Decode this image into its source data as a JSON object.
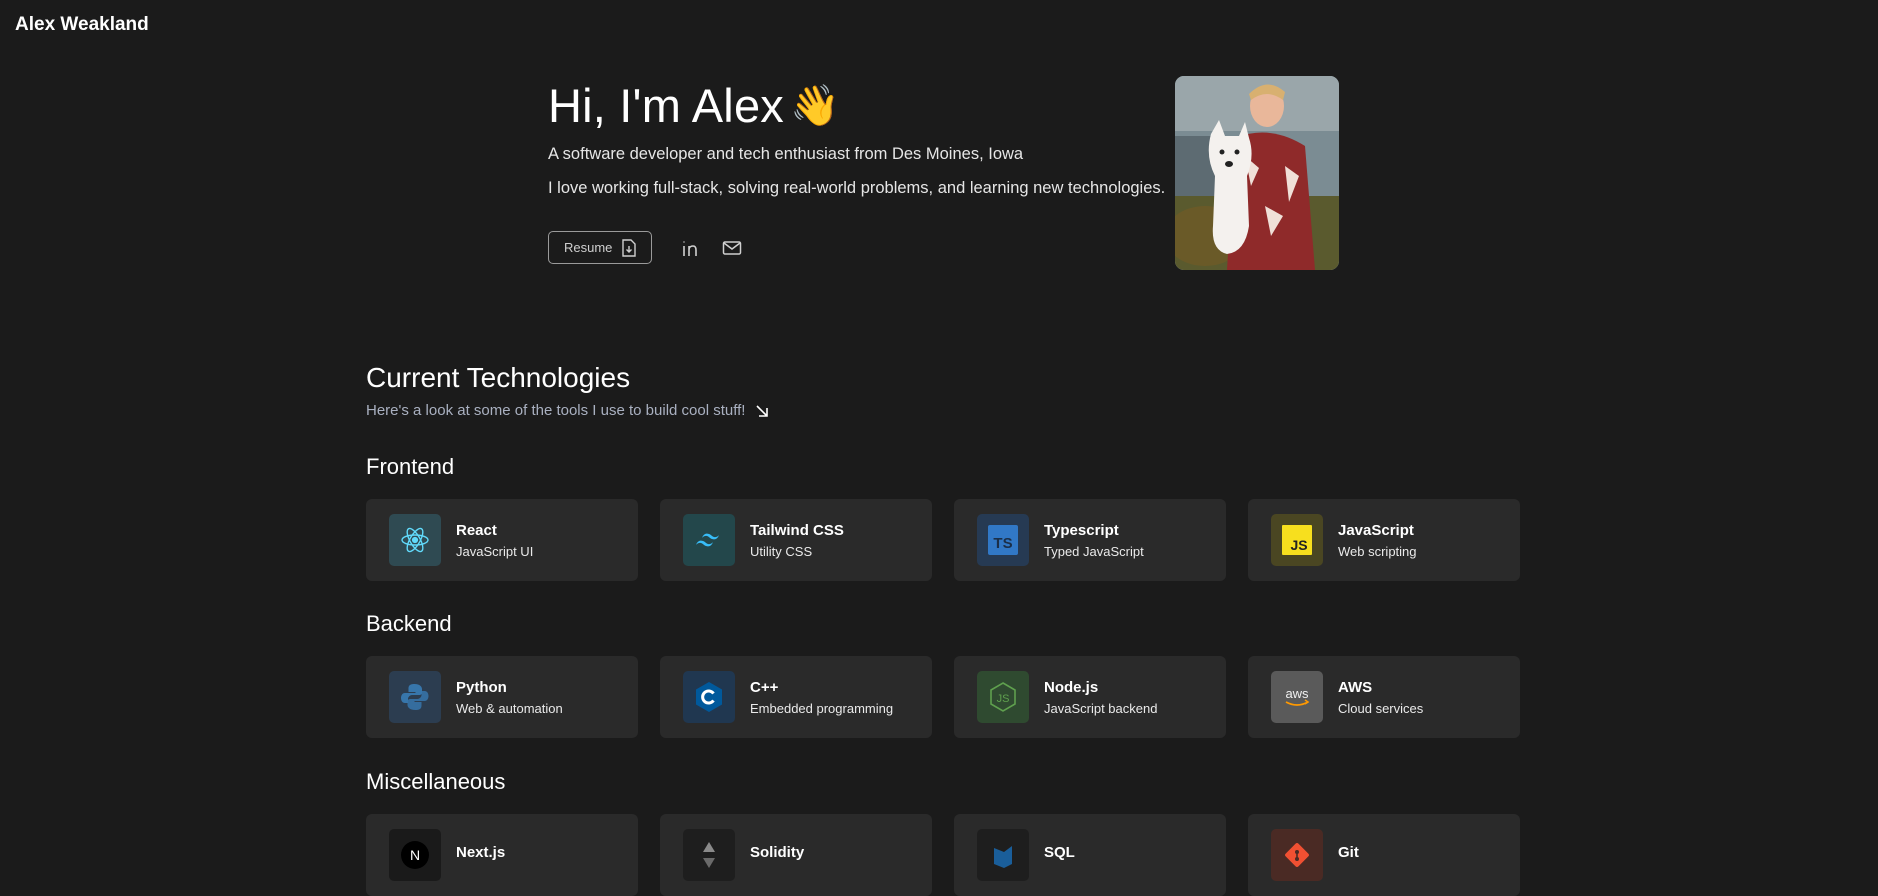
{
  "header": {
    "brand": "Alex Weakland"
  },
  "hero": {
    "title": "Hi, I'm Alex",
    "wave_emoji": "👋",
    "line1": "A software developer and tech enthusiast from Des Moines, Iowa",
    "line2": "I love working full-stack, solving real-world problems, and learning new technologies.",
    "resume_label": "Resume"
  },
  "tech": {
    "title": "Current Technologies",
    "subtitle": "Here's a look at some of the tools I use to build cool stuff!",
    "categories": [
      {
        "name": "Frontend",
        "items": [
          {
            "name": "React",
            "desc": "JavaScript UI",
            "icon": "react-icon",
            "bg": "#2f4a52"
          },
          {
            "name": "Tailwind CSS",
            "desc": "Utility CSS",
            "icon": "tailwind-icon",
            "bg": "#23474b"
          },
          {
            "name": "Typescript",
            "desc": "Typed JavaScript",
            "icon": "typescript-icon",
            "bg": "#263a53"
          },
          {
            "name": "JavaScript",
            "desc": "Web scripting",
            "icon": "javascript-icon",
            "bg": "#4a4622"
          }
        ]
      },
      {
        "name": "Backend",
        "items": [
          {
            "name": "Python",
            "desc": "Web & automation",
            "icon": "python-icon",
            "bg": "#2c3d50"
          },
          {
            "name": "C++",
            "desc": "Embedded programming",
            "icon": "cpp-icon",
            "bg": "#203750"
          },
          {
            "name": "Node.js",
            "desc": "JavaScript backend",
            "icon": "nodejs-icon",
            "bg": "#2f4a30"
          },
          {
            "name": "AWS",
            "desc": "Cloud services",
            "icon": "aws-icon",
            "bg": "#5a5a5a"
          }
        ]
      },
      {
        "name": "Miscellaneous",
        "items": [
          {
            "name": "Next.js",
            "desc": "",
            "icon": "nextjs-icon",
            "bg": "#1a1a1a"
          },
          {
            "name": "Solidity",
            "desc": "",
            "icon": "solidity-icon",
            "bg": "#1e1e1e"
          },
          {
            "name": "SQL",
            "desc": "",
            "icon": "sql-icon",
            "bg": "#1e1e1e"
          },
          {
            "name": "Git",
            "desc": "",
            "icon": "git-icon",
            "bg": "#4a2a24"
          }
        ]
      }
    ]
  },
  "colors": {
    "background": "#1b1b1b",
    "card": "#2a2a2a",
    "subtitle": "#a9b0c0"
  }
}
